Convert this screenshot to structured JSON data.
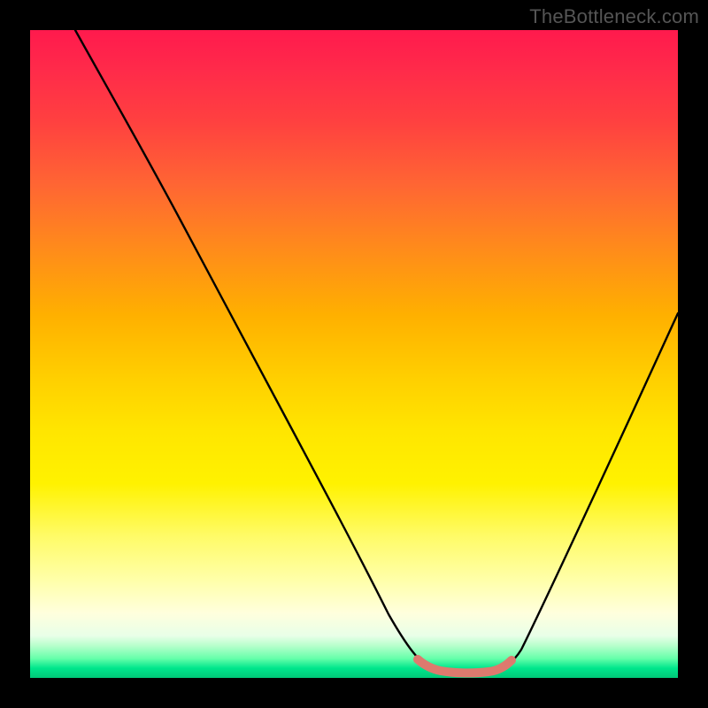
{
  "watermark": "TheBottleneck.com",
  "chart_data": {
    "type": "line",
    "title": "",
    "xlabel": "",
    "ylabel": "",
    "xlim": [
      0,
      100
    ],
    "ylim": [
      0,
      100
    ],
    "background": "rainbow-gradient-vertical",
    "series": [
      {
        "name": "curve",
        "color": "#000000",
        "x": [
          7,
          12,
          18,
          24,
          30,
          36,
          42,
          48,
          54,
          58,
          60,
          62,
          66,
          72,
          74,
          76,
          80,
          86,
          92,
          100
        ],
        "y": [
          100,
          92,
          82,
          72,
          62,
          52,
          42,
          32,
          20,
          10,
          5,
          2,
          2,
          2,
          3,
          6,
          14,
          28,
          44,
          68
        ]
      },
      {
        "name": "highlight-segment",
        "color": "#e0786a",
        "style": "thick",
        "x": [
          59,
          61,
          63,
          66,
          70,
          72,
          73,
          74
        ],
        "y": [
          3.2,
          2.4,
          2.1,
          2.0,
          2.0,
          2.2,
          2.6,
          3.4
        ]
      }
    ]
  }
}
